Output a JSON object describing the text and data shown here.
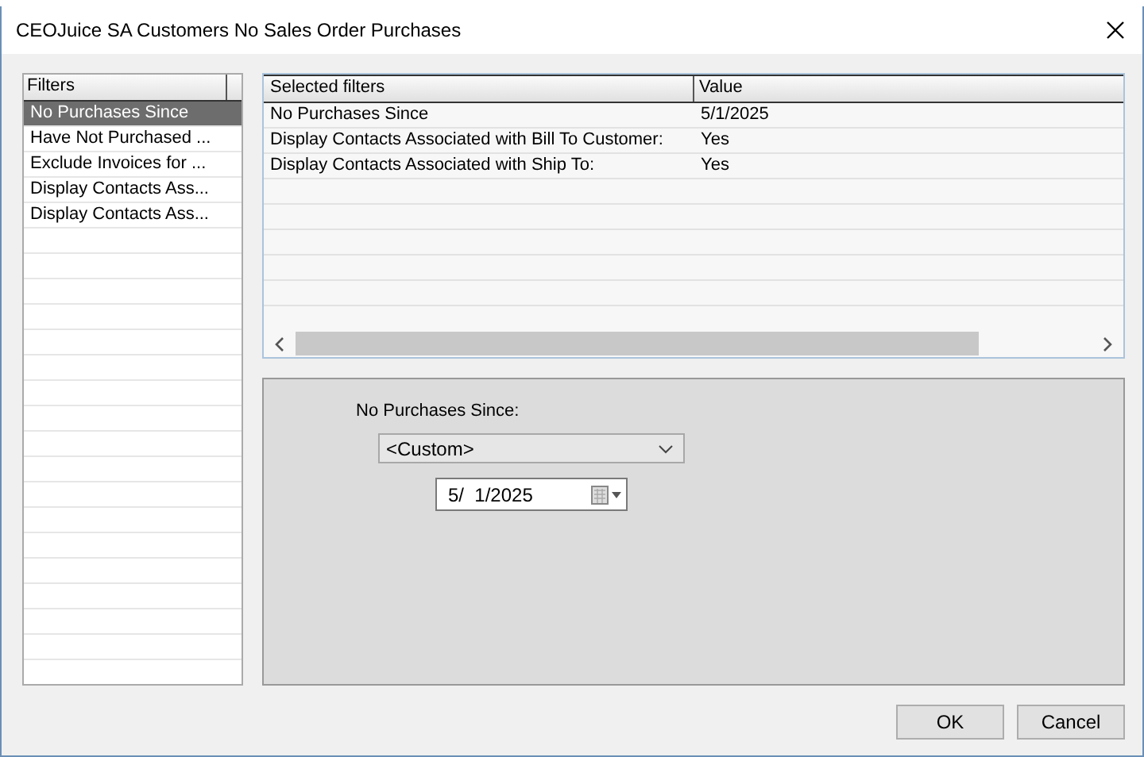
{
  "window": {
    "title": "CEOJuice SA Customers No Sales Order Purchases"
  },
  "filters": {
    "header": "Filters",
    "items": [
      {
        "label": "No Purchases Since",
        "selected": true
      },
      {
        "label": "Have Not Purchased ...",
        "selected": false
      },
      {
        "label": "Exclude Invoices for ...",
        "selected": false
      },
      {
        "label": "Display Contacts Ass...",
        "selected": false
      },
      {
        "label": "Display Contacts Ass...",
        "selected": false
      }
    ]
  },
  "selected_filters": {
    "columns": [
      "Selected filters",
      "Value"
    ],
    "rows": [
      [
        "No Purchases Since",
        "5/1/2025"
      ],
      [
        "Display Contacts Associated with Bill To Customer:",
        "Yes"
      ],
      [
        "Display Contacts Associated with Ship To:",
        "Yes"
      ]
    ]
  },
  "editor": {
    "label": "No Purchases Since:",
    "dropdown": "<Custom>",
    "date": "5/  1/2025"
  },
  "buttons": [
    "OK",
    "Cancel"
  ]
}
